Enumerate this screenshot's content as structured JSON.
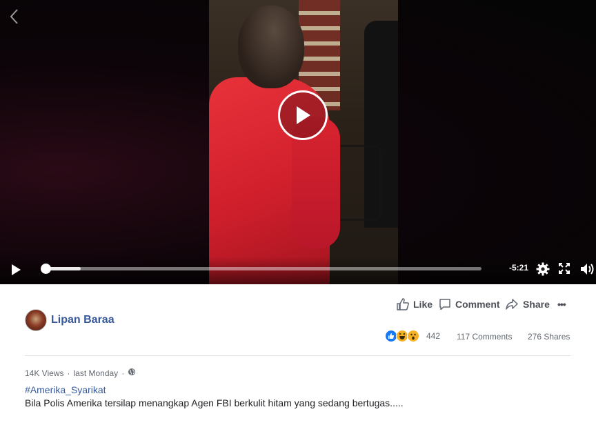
{
  "video": {
    "time_remaining": "-5:21",
    "progress_fraction": 0.0,
    "buffered_fraction": 0.08,
    "icons": {
      "back": "chevron-left-icon",
      "play_center": "play-circle-icon",
      "play": "play-icon",
      "settings": "gear-icon",
      "fullscreen": "fullscreen-icon",
      "volume": "volume-icon"
    }
  },
  "author": {
    "name": "Lipan Baraa"
  },
  "actions": {
    "like": "Like",
    "comment": "Comment",
    "share": "Share",
    "more": "•••"
  },
  "reactions": {
    "count": "442",
    "types": [
      "like",
      "haha",
      "wow"
    ],
    "colors": {
      "like": "#1877f2",
      "haha": "#f7b125",
      "wow": "#f7b125"
    }
  },
  "stats": {
    "comments": "117 Comments",
    "shares": "276 Shares"
  },
  "meta": {
    "views": "14K Views",
    "separator": "·",
    "date": "last Monday",
    "privacy_icon": "globe-icon"
  },
  "post": {
    "hashtag": "#Amerika_Syarikat",
    "caption": "Bila Polis Amerika tersilap menangkap Agen FBI berkulit hitam yang sedang bertugas....."
  },
  "colors": {
    "link": "#365899",
    "text": "#1c1e21",
    "muted": "#606770"
  }
}
